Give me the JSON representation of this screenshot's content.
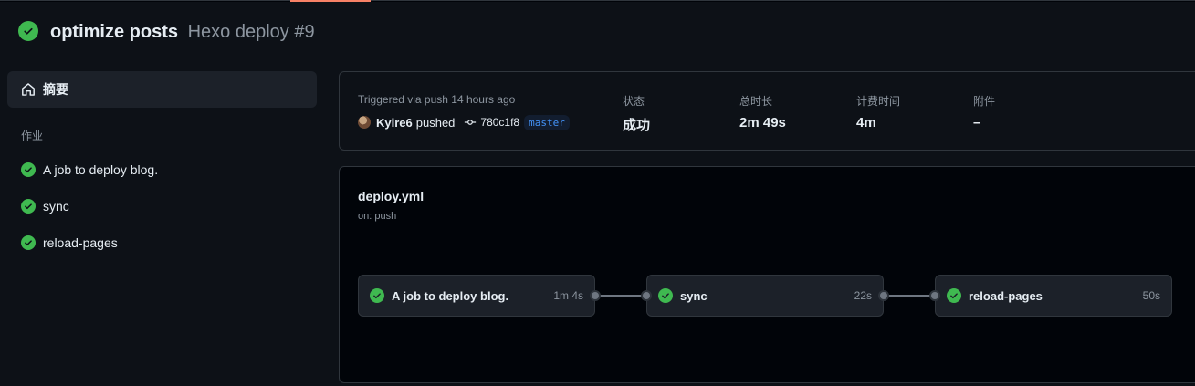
{
  "header": {
    "commit_message": "optimize posts",
    "workflow_run": "Hexo deploy #9",
    "status": "success"
  },
  "sidebar": {
    "summary_label": "摘要",
    "jobs_heading": "作业",
    "jobs": [
      {
        "label": "A job to deploy blog."
      },
      {
        "label": "sync"
      },
      {
        "label": "reload-pages"
      }
    ]
  },
  "summary": {
    "trigger_text": "Triggered via push 14 hours ago",
    "user": "Kyire6",
    "action": "pushed",
    "commit_sha": "780c1f8",
    "branch": "master",
    "status_label": "状态",
    "status_value": "成功",
    "duration_label": "总时长",
    "duration_value": "2m 49s",
    "billable_label": "计费时间",
    "billable_value": "4m",
    "artifacts_label": "附件",
    "artifacts_value": "–"
  },
  "graph": {
    "file_name": "deploy.yml",
    "trigger": "on: push",
    "jobs": [
      {
        "label": "A job to deploy blog.",
        "duration": "1m 4s"
      },
      {
        "label": "sync",
        "duration": "22s"
      },
      {
        "label": "reload-pages",
        "duration": "50s"
      }
    ]
  },
  "colors": {
    "success": "#3fb950",
    "accent": "#f78166",
    "branch": "#4493f8"
  },
  "icons": {
    "status": "check-circle-fill-icon",
    "summary": "home-icon",
    "commit": "git-commit-icon"
  }
}
